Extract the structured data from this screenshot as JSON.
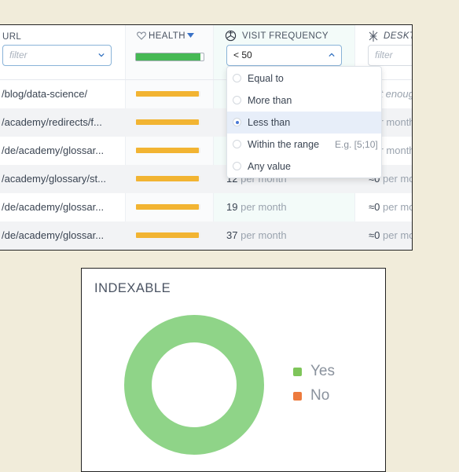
{
  "table": {
    "columns": {
      "url": {
        "label": "URL",
        "filter_placeholder": "filter"
      },
      "health": {
        "label": "HEALTH",
        "health_fill": 0.95
      },
      "visit": {
        "label": "VISIT FREQUENCY",
        "filter_value": "< 50"
      },
      "desktop": {
        "label": "DESKT",
        "filter_placeholder": "filter"
      }
    },
    "rows": [
      {
        "url": "/blog/data-science/",
        "health_fill": 0.98,
        "visit_num": "",
        "visit_unit": "",
        "desk_num": "",
        "desk_unit": "not enough"
      },
      {
        "url": "/academy/redirects/f...",
        "health_fill": 0.98,
        "visit_num": "",
        "visit_unit": "",
        "desk_num": "",
        "desk_unit": "per month"
      },
      {
        "url": "/de/academy/glossar...",
        "health_fill": 0.98,
        "visit_num": "",
        "visit_unit": "",
        "desk_num": "",
        "desk_unit": "per month"
      },
      {
        "url": "/academy/glossary/st...",
        "health_fill": 0.98,
        "visit_num": "12",
        "visit_unit": "per month",
        "desk_num": "≈0",
        "desk_unit": "per month"
      },
      {
        "url": "/de/academy/glossar...",
        "health_fill": 0.98,
        "visit_num": "19",
        "visit_unit": "per month",
        "desk_num": "≈0",
        "desk_unit": "per month"
      },
      {
        "url": "/de/academy/glossar...",
        "health_fill": 0.98,
        "visit_num": "37",
        "visit_unit": "per month",
        "desk_num": "≈0",
        "desk_unit": "per month"
      }
    ]
  },
  "dropdown": {
    "options": [
      {
        "label": "Equal to",
        "selected": false,
        "hint": ""
      },
      {
        "label": "More than",
        "selected": false,
        "hint": ""
      },
      {
        "label": "Less than",
        "selected": true,
        "hint": ""
      },
      {
        "label": "Within the range",
        "selected": false,
        "hint": "E.g. [5;10]"
      },
      {
        "label": "Any value",
        "selected": false,
        "hint": ""
      }
    ]
  },
  "chart": {
    "title": "INDEXABLE",
    "legend": [
      {
        "label": "Yes",
        "color": "#7ec55a"
      },
      {
        "label": "No",
        "color": "#ed7a3d"
      }
    ]
  },
  "chart_data": {
    "type": "pie",
    "title": "INDEXABLE",
    "categories": [
      "Yes",
      "No"
    ],
    "values": [
      100,
      0
    ],
    "colors": [
      "#8fd488",
      "#ed7a3d"
    ],
    "donut": true,
    "legend_position": "right"
  },
  "colors": {
    "health_good": "#46b954",
    "health_warn": "#f2b432",
    "accent_blue": "#4a79d6"
  }
}
